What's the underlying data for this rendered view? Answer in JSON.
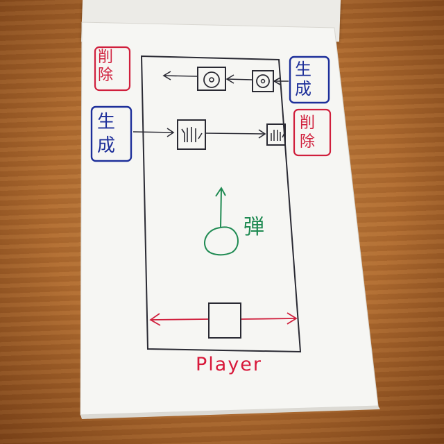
{
  "sketch": {
    "top_left_label": [
      "削",
      "除"
    ],
    "top_right_label": [
      "生",
      "成"
    ],
    "mid_left_label": [
      "生",
      "成"
    ],
    "mid_right_label": [
      "削",
      "除"
    ],
    "bullet_label": "弾",
    "player_label": "Player"
  },
  "colors": {
    "red_ink": "#d01f3c",
    "blue_ink": "#1d2f9a",
    "green_ink": "#1f8a52",
    "black_ink": "#2a2a33"
  }
}
